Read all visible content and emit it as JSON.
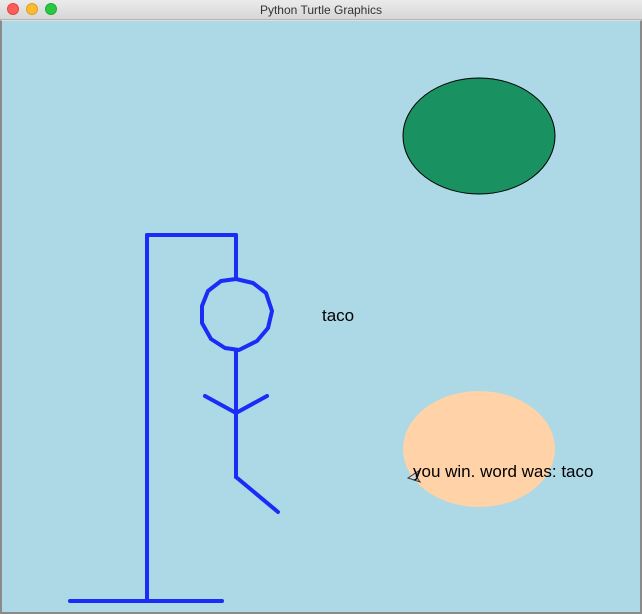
{
  "window": {
    "title": "Python Turtle Graphics"
  },
  "canvas": {
    "background": "#add8e6",
    "word_label": "taco",
    "result_message": "you win. word was: taco"
  },
  "colors": {
    "gallows_and_figure": "#1a2cf5",
    "top_circle_fill": "#1a9160",
    "bottom_circle_fill": "#ffd2a8"
  },
  "icons": {
    "turtle_cursor": "turtle-arrow-icon"
  }
}
